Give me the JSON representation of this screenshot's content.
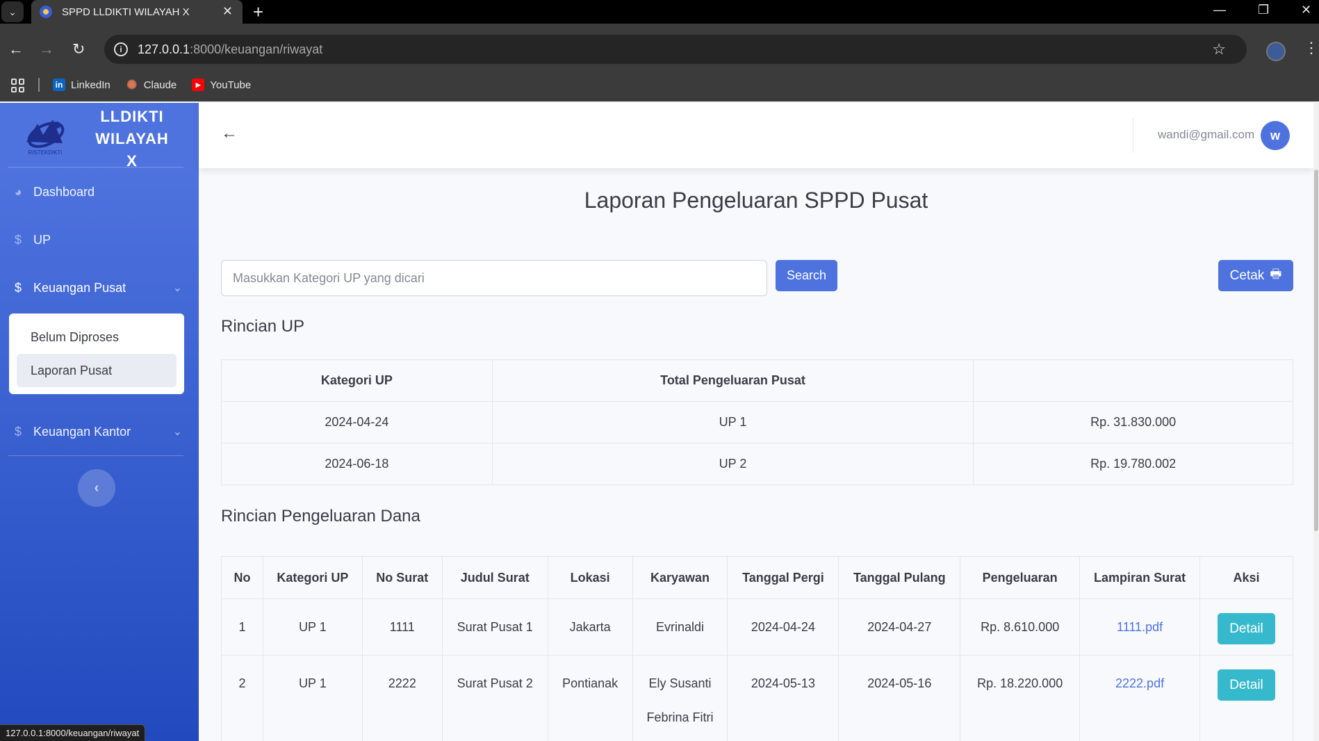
{
  "browser": {
    "tab_title": "SPPD LLDIKTI WILAYAH X",
    "url_host": "127.0.0.1",
    "url_path": ":8000/keuangan/riwayat",
    "bookmarks": [
      {
        "label": "LinkedIn",
        "icon": "linkedin-icon",
        "color": "#0a66c2"
      },
      {
        "label": "Claude",
        "icon": "claude-icon",
        "color": "#d97757"
      },
      {
        "label": "YouTube",
        "icon": "youtube-icon",
        "color": "#ff0000"
      }
    ],
    "status_url": "127.0.0.1:8000/keuangan/riwayat"
  },
  "sidebar": {
    "brand": "LLDIKTI WILAYAH X",
    "logo_caption": "RISTEKDIKTI",
    "items": [
      {
        "label": "Dashboard",
        "icon": "tachometer-icon"
      },
      {
        "label": "UP",
        "icon": "dollar-icon"
      },
      {
        "label": "Keuangan Pusat",
        "icon": "dollar-icon"
      },
      {
        "label": "Keuangan Kantor",
        "icon": "dollar-icon"
      }
    ],
    "submenu": [
      "Belum Diproses",
      "Laporan Pusat"
    ],
    "colors": {
      "gradient_start": "#4e73df",
      "gradient_end": "#224abe"
    }
  },
  "topbar": {
    "user_email": "wandi@gmail.com",
    "avatar_initial": "w"
  },
  "main": {
    "title": "Laporan Pengeluaran SPPD Pusat",
    "search_placeholder": "Masukkan Kategori UP yang dicari",
    "search_button": "Search",
    "print_button": "Cetak",
    "rincian_up_title": "Rincian UP",
    "rincian_up_headers": [
      "Kategori UP",
      "Total Pengeluaran Pusat",
      ""
    ],
    "rincian_up_rows": [
      [
        "2024-04-24",
        "UP 1",
        "Rp. 31.830.000"
      ],
      [
        "2024-06-18",
        "UP 2",
        "Rp. 19.780.002"
      ]
    ],
    "dana_title": "Rincian Pengeluaran Dana",
    "dana_headers": [
      "No",
      "Kategori UP",
      "No Surat",
      "Judul Surat",
      "Lokasi",
      "Karyawan",
      "Tanggal Pergi",
      "Tanggal Pulang",
      "Pengeluaran",
      "Lampiran Surat",
      "Aksi"
    ],
    "dana_rows": [
      {
        "no": "1",
        "kategori": "UP 1",
        "no_surat": "1111",
        "judul": "Surat Pusat 1",
        "lokasi": "Jakarta",
        "karyawan": [
          "Evrinaldi"
        ],
        "pergi": "2024-04-24",
        "pulang": "2024-04-27",
        "pengeluaran": "Rp. 8.610.000",
        "lampiran": "1111.pdf",
        "aksi": "Detail"
      },
      {
        "no": "2",
        "kategori": "UP 1",
        "no_surat": "2222",
        "judul": "Surat Pusat 2",
        "lokasi": "Pontianak",
        "karyawan": [
          "Ely Susanti",
          "Febrina Fitri"
        ],
        "pergi": "2024-05-13",
        "pulang": "2024-05-16",
        "pengeluaran": "Rp. 18.220.000",
        "lampiran": "2222.pdf",
        "aksi": "Detail"
      }
    ]
  },
  "colors": {
    "primary": "#4e73df",
    "info": "#36b9cc",
    "bg": "#f8f9fc"
  }
}
